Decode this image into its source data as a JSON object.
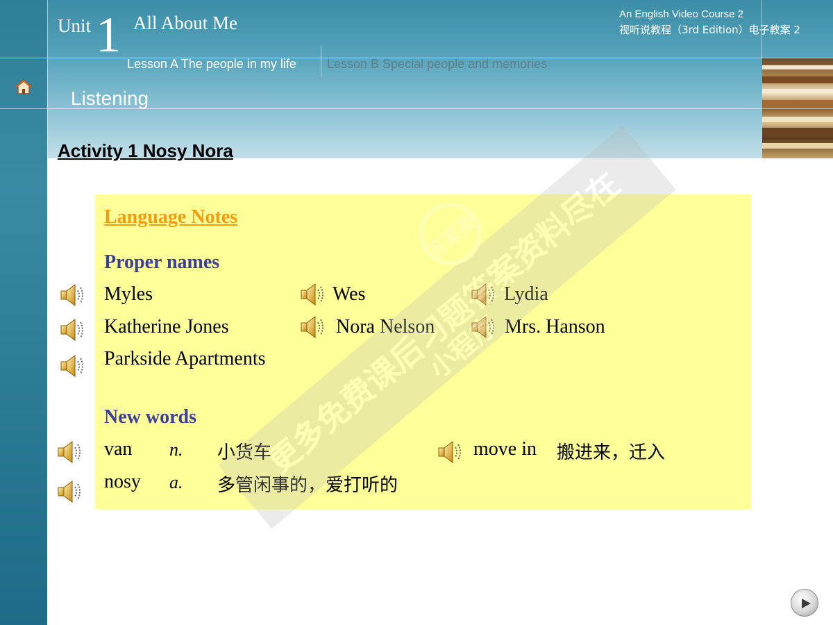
{
  "header": {
    "unit_word": "Unit",
    "unit_number": "1",
    "unit_title": "All About Me",
    "course_en": "An English Video Course 2",
    "course_cn": "视听说教程（3rd Edition）电子教案 2",
    "lesson_a": "Lesson A The people in my life",
    "lesson_b": "Lesson B Special people and memories",
    "section": "Listening"
  },
  "activity": {
    "title": "Activity 1  Nosy Nora"
  },
  "notes": {
    "heading": "Language Notes",
    "proper_names": {
      "heading": "Proper names",
      "items": [
        "Myles",
        "Wes",
        "Lydia",
        "Katherine Jones",
        "Nora Nelson",
        "Mrs. Hanson",
        "Parkside Apartments"
      ]
    },
    "new_words": {
      "heading": "New words",
      "items": [
        {
          "word": "van",
          "pos": "n.",
          "meaning": "小货车"
        },
        {
          "word": "move in",
          "pos": "",
          "meaning": "搬进来，迁入"
        },
        {
          "word": "nosy",
          "pos": "a.",
          "meaning": "多管闲事的，爱打听的"
        }
      ]
    }
  },
  "watermark": {
    "line1": "更多免费课后习题答案资料尽在",
    "line2": "小程序",
    "badge": "答案圈"
  },
  "icons": {
    "home": "home-icon",
    "speaker": "speaker-icon",
    "next": "play-triangle-icon"
  },
  "colors": {
    "heading_orange": "#f39c12",
    "subheading_blue": "#3c3f99",
    "box_yellow": "#ffff99"
  }
}
